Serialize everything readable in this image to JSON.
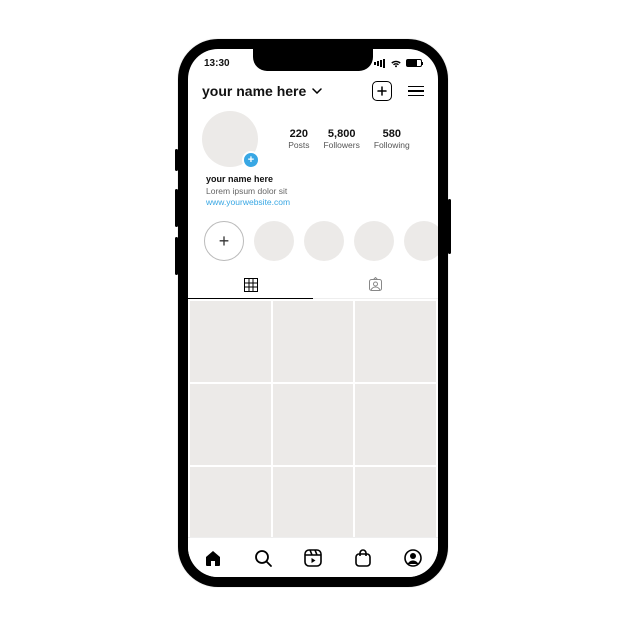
{
  "status": {
    "time": "13:30"
  },
  "header": {
    "username": "your name here"
  },
  "profile": {
    "stats": {
      "posts": {
        "value": "220",
        "label": "Posts"
      },
      "followers": {
        "value": "5,800",
        "label": "Followers"
      },
      "following": {
        "value": "580",
        "label": "Following"
      }
    },
    "bio": {
      "name": "your name here",
      "text": "Lorem ipsum dolor sit",
      "link": "www.yourwebsite.com"
    }
  },
  "highlights": {
    "new_label": "+"
  },
  "colors": {
    "accent": "#38a7e4",
    "placeholder": "#eceae8"
  }
}
